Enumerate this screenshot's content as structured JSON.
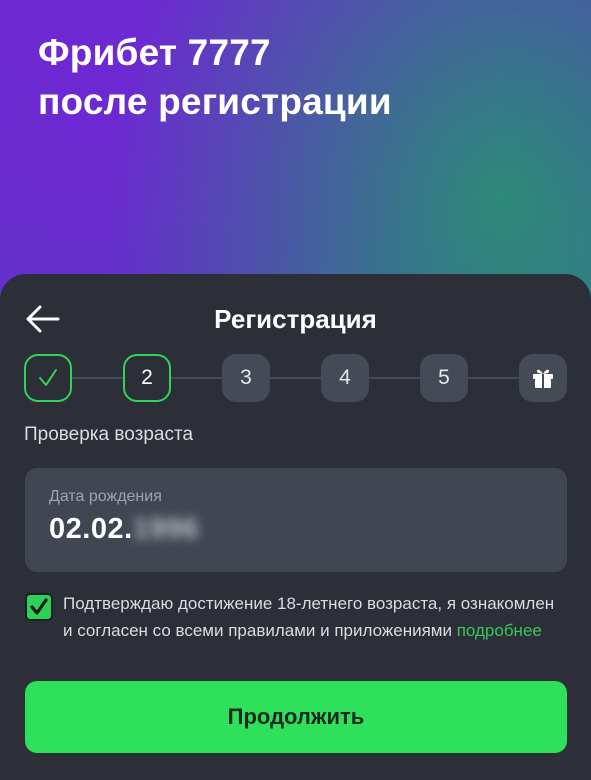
{
  "promo": {
    "title_line1": "Фрибет 7777",
    "title_line2": "после регистрации"
  },
  "sheet": {
    "title": "Регистрация",
    "back_icon": "arrow-left-icon"
  },
  "steps": [
    {
      "label": "",
      "state": "done",
      "icon": "check-icon"
    },
    {
      "label": "2",
      "state": "active"
    },
    {
      "label": "3",
      "state": "pending"
    },
    {
      "label": "4",
      "state": "pending"
    },
    {
      "label": "5",
      "state": "pending"
    },
    {
      "label": "",
      "state": "pending",
      "icon": "gift-icon"
    }
  ],
  "section": {
    "label": "Проверка возраста"
  },
  "birth_date": {
    "placeholder": "Дата рождения",
    "value_visible": "02.02.",
    "value_obscured": "1996"
  },
  "consent": {
    "checked": true,
    "text": "Подтверждаю достижение 18-летнего возраста, я ознакомлен и согласен со всеми правилами и приложениями ",
    "link": "подробнее"
  },
  "continue_button": {
    "label": "Продолжить"
  },
  "colors": {
    "accent_green": "#2ee05a",
    "link_green": "#34c75a",
    "sheet_bg": "#2c2f37",
    "field_bg": "#404652"
  }
}
